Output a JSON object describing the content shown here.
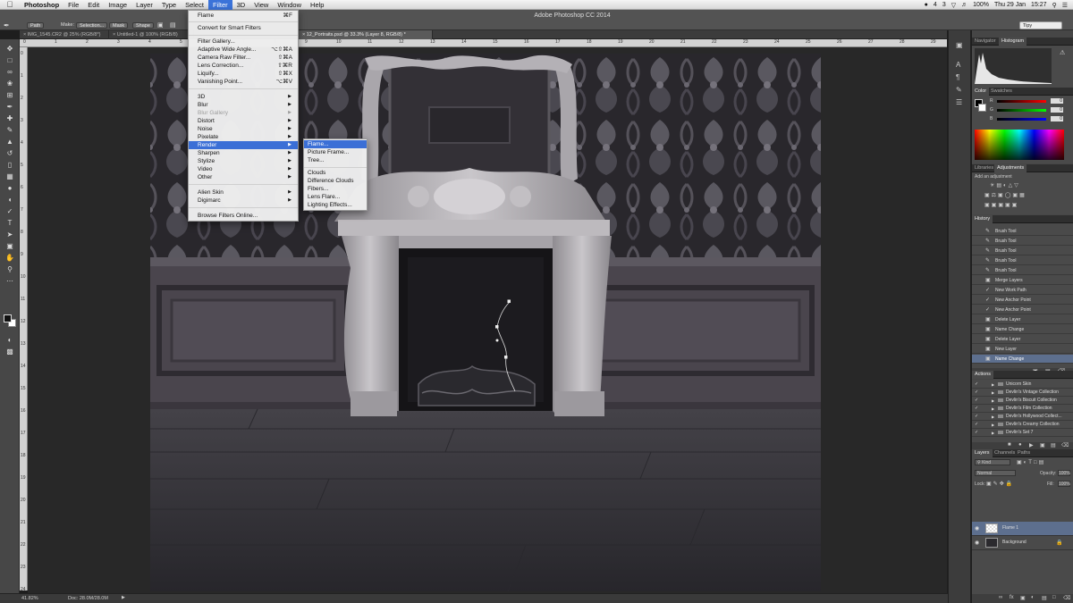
{
  "menubar": {
    "app_name": "Photoshop",
    "items": [
      "File",
      "Edit",
      "Image",
      "Layer",
      "Type",
      "Select",
      "Filter",
      "3D",
      "View",
      "Window",
      "Help"
    ],
    "active_item": "Filter",
    "status_right": [
      "4",
      "3",
      "100%",
      "Thu 29 Jan",
      "15:27"
    ]
  },
  "window": {
    "title": "Adobe Photoshop CC 2014"
  },
  "options_bar": {
    "path_mode": "Path",
    "make_label": "Make:",
    "selection_btn": "Selection...",
    "mask_btn": "Mask",
    "shape_btn": "Shape",
    "workspace": "Tipy"
  },
  "tabs": [
    {
      "label": "IMG_1545.CR2 @ 25% (RGB/8*)"
    },
    {
      "label": "Untitled-1 @ 100% (RGB/8)"
    },
    {
      "label": "12_Portraits.psd @ 33.3% (Layer 8, RGB/8) *"
    }
  ],
  "ruler": {
    "h_ticks": [
      "0",
      "1",
      "2",
      "3",
      "4",
      "5",
      "6",
      "7",
      "8",
      "9",
      "10",
      "11",
      "12",
      "13",
      "14",
      "15",
      "16",
      "17",
      "18",
      "19",
      "20",
      "21",
      "22",
      "23",
      "24",
      "25",
      "26",
      "27",
      "28",
      "29"
    ],
    "v_ticks": [
      "0",
      "1",
      "2",
      "3",
      "4",
      "5",
      "6",
      "7",
      "8",
      "9",
      "10",
      "11",
      "12",
      "13",
      "14",
      "15",
      "16",
      "17",
      "18",
      "19",
      "20",
      "21",
      "22",
      "23",
      "24"
    ]
  },
  "filter_menu": {
    "items": [
      {
        "label": "Flame",
        "shortcut": "⌘F"
      },
      {
        "sep": true
      },
      {
        "label": "Convert for Smart Filters"
      },
      {
        "sep": true
      },
      {
        "label": "Filter Gallery..."
      },
      {
        "label": "Adaptive Wide Angle...",
        "shortcut": "⌥⇧⌘A"
      },
      {
        "label": "Camera Raw Filter...",
        "shortcut": "⇧⌘A"
      },
      {
        "label": "Lens Correction...",
        "shortcut": "⇧⌘R"
      },
      {
        "label": "Liquify...",
        "shortcut": "⇧⌘X"
      },
      {
        "label": "Vanishing Point...",
        "shortcut": "⌥⌘V"
      },
      {
        "sep": true
      },
      {
        "label": "3D",
        "submenu": true
      },
      {
        "label": "Blur",
        "submenu": true
      },
      {
        "label": "Blur Gallery",
        "submenu": true,
        "disabled": true
      },
      {
        "label": "Distort",
        "submenu": true
      },
      {
        "label": "Noise",
        "submenu": true
      },
      {
        "label": "Pixelate",
        "submenu": true
      },
      {
        "label": "Render",
        "submenu": true,
        "highlighted": true
      },
      {
        "label": "Sharpen",
        "submenu": true
      },
      {
        "label": "Stylize",
        "submenu": true
      },
      {
        "label": "Video",
        "submenu": true
      },
      {
        "label": "Other",
        "submenu": true
      },
      {
        "sep": true
      },
      {
        "label": "Alien Skin",
        "submenu": true
      },
      {
        "label": "Digimarc",
        "submenu": true
      },
      {
        "sep": true
      },
      {
        "label": "Browse Filters Online..."
      }
    ]
  },
  "render_submenu": {
    "items": [
      {
        "label": "Flame...",
        "highlighted": true
      },
      {
        "label": "Picture Frame..."
      },
      {
        "label": "Tree..."
      },
      {
        "sep": true
      },
      {
        "label": "Clouds"
      },
      {
        "label": "Difference Clouds"
      },
      {
        "label": "Fibers..."
      },
      {
        "label": "Lens Flare..."
      },
      {
        "label": "Lighting Effects..."
      }
    ]
  },
  "status_bar": {
    "zoom": "41.82%",
    "doc": "Doc: 28.0M/28.0M"
  },
  "panels": {
    "nav_tabs": [
      "Navigator",
      "Histogram"
    ],
    "color_tabs": [
      "Color",
      "Swatches"
    ],
    "color_values": {
      "r": "0",
      "g": "0",
      "b": "0",
      "r_label": "R",
      "g_label": "G",
      "b_label": "B"
    },
    "adj_tabs": [
      "Libraries",
      "Adjustments"
    ],
    "adj_title": "Add an adjustment",
    "history_tab": "History",
    "history": [
      {
        "label": "Brush Tool"
      },
      {
        "label": "Brush Tool"
      },
      {
        "label": "Brush Tool"
      },
      {
        "label": "Brush Tool"
      },
      {
        "label": "Brush Tool"
      },
      {
        "label": "Merge Layers"
      },
      {
        "label": "New Work Path"
      },
      {
        "label": "New Anchor Point"
      },
      {
        "label": "New Anchor Point"
      },
      {
        "label": "Delete Layer"
      },
      {
        "label": "Name Change"
      },
      {
        "label": "Delete Layer"
      },
      {
        "label": "New Layer"
      },
      {
        "label": "Name Change",
        "selected": true
      }
    ],
    "actions_tab": "Actions",
    "actions": [
      {
        "label": "Unicorn Skin"
      },
      {
        "label": "Devlin's Vintage Collection"
      },
      {
        "label": "Devlin's Biscuit Collection"
      },
      {
        "label": "Devlin's Film Collection"
      },
      {
        "label": "Devlin's Hollywood Collect..."
      },
      {
        "label": "Devlin's Creamy Collection"
      },
      {
        "label": "Devlin's Set 7"
      }
    ],
    "layer_tabs": [
      "Layers",
      "Channels",
      "Paths"
    ],
    "layer_filter": "Kind",
    "blend_mode": "Normal",
    "opacity_label": "Opacity:",
    "opacity": "100%",
    "lock_label": "Lock:",
    "fill_label": "Fill:",
    "fill": "100%",
    "layers": [
      {
        "name": "Flame 1",
        "selected": true
      },
      {
        "name": "Background"
      }
    ]
  }
}
